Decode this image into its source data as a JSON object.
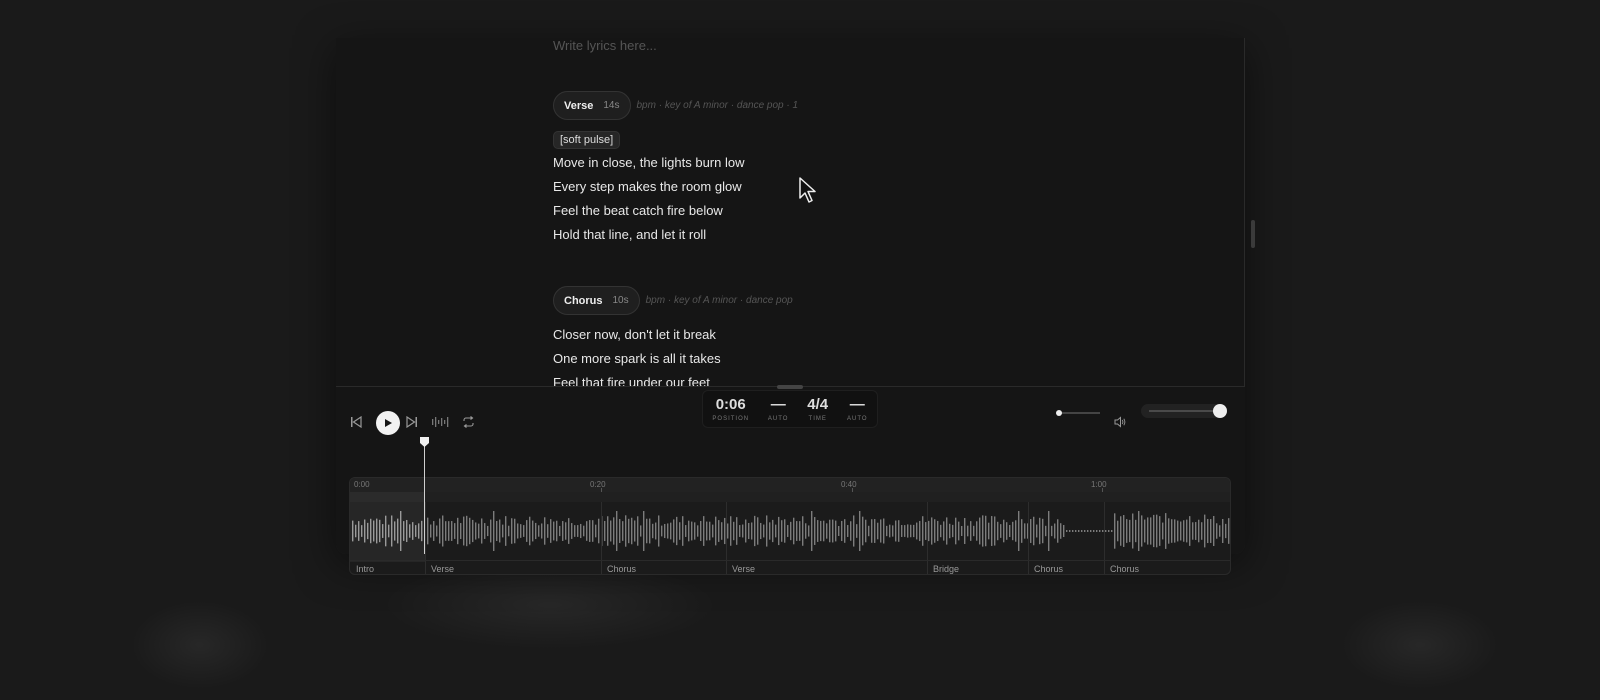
{
  "editor": {
    "placeholder": "Write lyrics here...",
    "sections": [
      {
        "name": "Verse",
        "duration": "14s",
        "meta": "bpm · key of A minor · dance pop · 1",
        "tag": "[soft pulse]",
        "lines": [
          "Move in close, the lights burn low",
          "Every step makes the room glow",
          "Feel the beat catch fire below",
          "Hold that line, and let it roll"
        ]
      },
      {
        "name": "Chorus",
        "duration": "10s",
        "meta": "bpm · key of A minor · dance pop",
        "lines": [
          "Closer now, don't let it break",
          "One more spark is all it takes",
          "Feel that fire under our feet"
        ]
      }
    ]
  },
  "transport": {
    "position": "0:06",
    "position_label": "POSITION",
    "auto1": "—",
    "auto1_label": "AUTO",
    "time": "4/4",
    "time_label": "TIME",
    "auto2": "—",
    "auto2_label": "AUTO",
    "buttons": [
      "skip-back-icon",
      "play-icon",
      "skip-forward-icon",
      "waveform-icon",
      "loop-icon"
    ],
    "volume_icon": "speaker-icon",
    "volume_level": 0.95,
    "secondary_slider_level": 0.0
  },
  "timeline": {
    "ruler": [
      "0:00",
      "0:20",
      "0:40",
      "1:00"
    ],
    "playhead_time": "0:06",
    "segments": [
      "Intro",
      "Verse",
      "Chorus",
      "Verse",
      "Bridge",
      "Chorus",
      "Chorus"
    ]
  }
}
